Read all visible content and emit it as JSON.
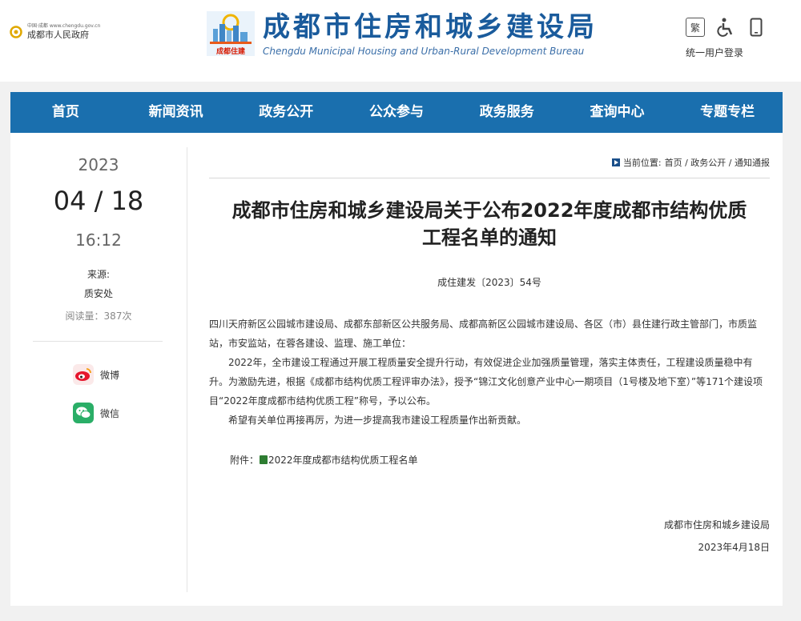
{
  "header": {
    "gov_small": "中国·成都 www.chengdu.gov.cn",
    "gov_name": "成都市人民政府",
    "emblem_caption": "成都住建",
    "title": "成都市住房和城乡建设局",
    "title_en": "Chengdu Municipal Housing and Urban-Rural Development Bureau",
    "fan_label": "繁",
    "login_label": "统一用户登录"
  },
  "nav": {
    "items": [
      "首页",
      "新闻资讯",
      "政务公开",
      "公众参与",
      "政务服务",
      "查询中心",
      "专题专栏"
    ]
  },
  "side": {
    "year": "2023",
    "month_day": "04 / 18",
    "time": "16:12",
    "source_label": "来源:",
    "source": "质安处",
    "reads": "阅读量：387次",
    "weibo_label": "微博",
    "wechat_label": "微信"
  },
  "breadcrumb": {
    "label": "当前位置:",
    "path": "首页 / 政务公开 / 通知通报"
  },
  "article": {
    "title_line1": "成都市住房和城乡建设局关于公布2022年度成都市结构优质",
    "title_line2": "工程名单的通知",
    "doc_no": "成住建发〔2023〕54号",
    "para1": "四川天府新区公园城市建设局、成都东部新区公共服务局、成都高新区公园城市建设局、各区（市）县住建行政主管部门，市质监站，市安监站，在蓉各建设、监理、施工单位：",
    "para2": "2022年，全市建设工程通过开展工程质量安全提升行动，有效促进企业加强质量管理，落实主体责任，工程建设质量稳中有升。为激励先进，根据《成都市结构优质工程评审办法》，授予“锦江文化创意产业中心一期项目（1号楼及地下室）”等171个建设项目“2022年度成都市结构优质工程”称号，予以公布。",
    "para3": "希望有关单位再接再厉，为进一步提高我市建设工程质量作出新贡献。",
    "attach_label": "附件：",
    "attach_name": "2022年度成都市结构优质工程名单",
    "signer": "成都市住房和城乡建设局",
    "sign_date": "2023年4月18日"
  },
  "colors": {
    "nav_bg": "#1a6fae",
    "title_blue": "#1a5b9c",
    "weibo": "#e6162d",
    "wechat": "#2aae67"
  }
}
